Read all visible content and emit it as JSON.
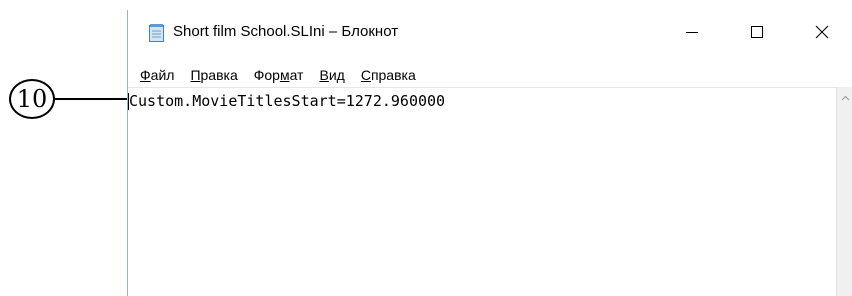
{
  "callout": {
    "number": "10"
  },
  "window": {
    "title": "Short film School.SLIni – Блокнот",
    "icons": {
      "app": "notepad-icon",
      "minimize": "minimize-icon",
      "maximize": "maximize-icon",
      "close": "close-icon",
      "scroll_up": "scroll-up-arrow-icon"
    },
    "colors": {
      "border": "#8fb6e6",
      "scrollbar": "#f0f0f0"
    }
  },
  "menu": {
    "items": [
      {
        "accel": "Ф",
        "rest": "айл"
      },
      {
        "accel": "П",
        "rest": "равка"
      },
      {
        "pre": "Фор",
        "accel": "м",
        "rest": "ат"
      },
      {
        "accel": "В",
        "rest": "ид"
      },
      {
        "accel": "С",
        "rest": "правка"
      }
    ]
  },
  "editor": {
    "content": "Custom.MovieTitlesStart=1272.960000"
  }
}
